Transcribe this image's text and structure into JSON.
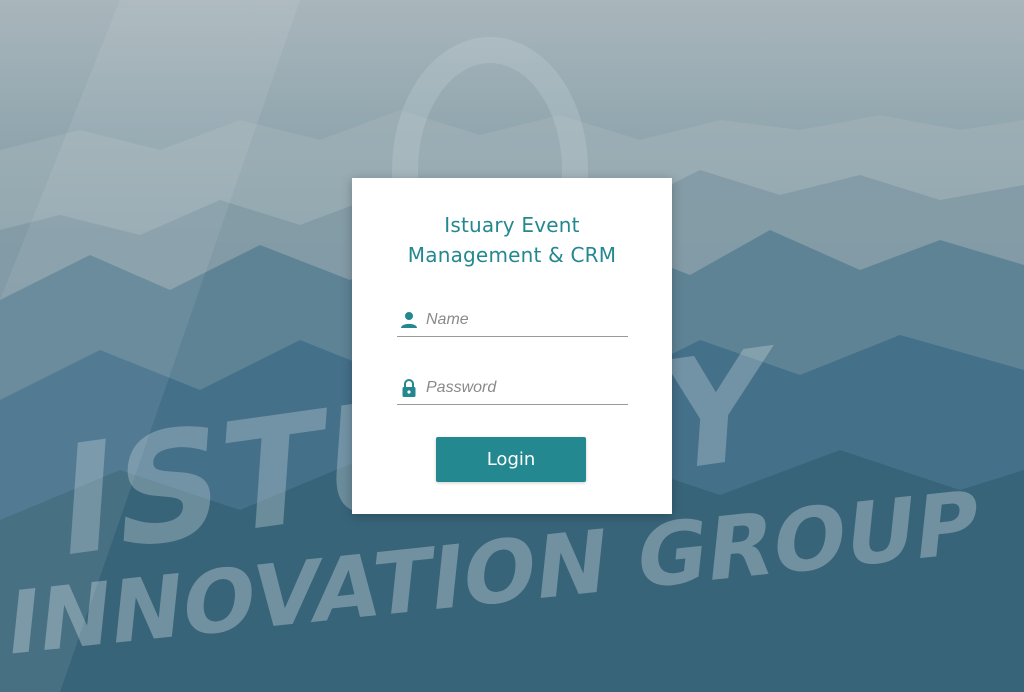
{
  "background": {
    "logo_line1": "ISTUARY",
    "logo_line2": "INNOVATION GROUP"
  },
  "login": {
    "title_line1": "Istuary Event",
    "title_line2": "Management & CRM",
    "name_placeholder": "Name",
    "name_value": "",
    "password_placeholder": "Password",
    "password_value": "",
    "login_label": "Login"
  },
  "colors": {
    "accent": "#23888f",
    "card": "#ffffff"
  },
  "icons": {
    "name": "person-icon",
    "password": "lock-icon"
  }
}
